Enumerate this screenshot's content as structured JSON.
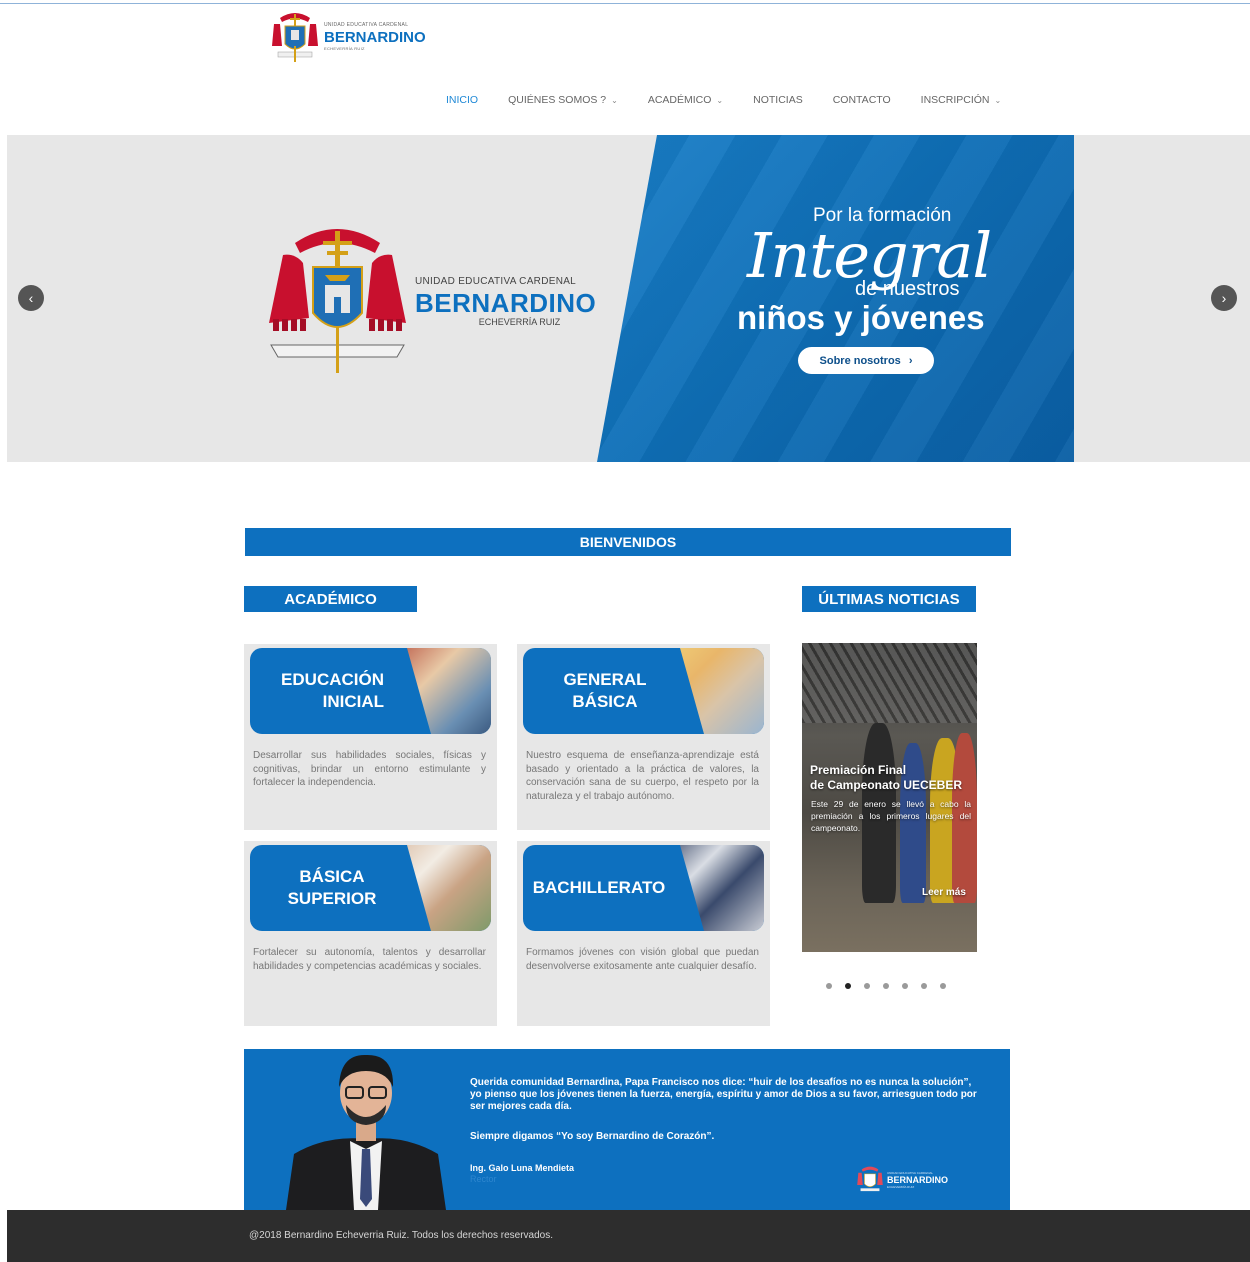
{
  "header": {
    "logo": {
      "small": "UNIDAD EDUCATIVA CARDENAL",
      "big": "BERNARDINO",
      "sub": "ECHEVERRÍA RUIZ"
    },
    "nav": [
      {
        "label": "INICIO",
        "active": true,
        "dropdown": false
      },
      {
        "label": "QUIÉNES SOMOS ?",
        "active": false,
        "dropdown": true
      },
      {
        "label": "ACADÉMICO",
        "active": false,
        "dropdown": true
      },
      {
        "label": "NOTICIAS",
        "active": false,
        "dropdown": false
      },
      {
        "label": "CONTACTO",
        "active": false,
        "dropdown": false
      },
      {
        "label": "INSCRIPCIÓN",
        "active": false,
        "dropdown": true
      }
    ]
  },
  "hero": {
    "logo_small": "UNIDAD EDUCATIVA CARDENAL",
    "logo_big": "BERNARDINO",
    "logo_sub": "ECHEVERRÍA RUIZ",
    "crest_motto": "PAX ET BONUM",
    "line1": "Por la formación",
    "script": "Integral",
    "line3": "de nuestros",
    "line4": "niños y jóvenes",
    "button": "Sobre nosotros",
    "prev_icon": "chevron-left-icon",
    "next_icon": "chevron-right-icon"
  },
  "welcome": "BIENVENIDOS",
  "academic": {
    "heading": "ACADÉMICO",
    "cards": [
      {
        "title_line1": "EDUCACIÓN",
        "title_line2": "INICIAL",
        "desc": "Desarrollar sus habilidades sociales, físicas y cognitivas, brindar un entorno estimulante y fortalecer la independencia."
      },
      {
        "title_line1": "GENERAL",
        "title_line2": "BÁSICA",
        "desc": "Nuestro esquema de enseñanza-aprendizaje está basado y orientado a la práctica de valores, la conservación sana de su cuerpo, el respeto por la naturaleza y el trabajo autónomo."
      },
      {
        "title_line1": "BÁSICA",
        "title_line2": "SUPERIOR",
        "desc": "Fortalecer su autonomía, talentos y desarrollar habilidades y competencias académicas y sociales."
      },
      {
        "title_line1": "BACHILLERATO",
        "title_line2": "",
        "desc": "Formamos jóvenes con visión global que puedan desenvolverse exitosamente ante cualquier desafío."
      }
    ]
  },
  "news": {
    "heading": "ÚLTIMAS NOTICIAS",
    "title_line1": "Premiación Final",
    "title_line2": "de Campeonato UECEBER",
    "text": "Este 29 de enero se llevó a cabo la premiación a los primeros lugares del campeonato.",
    "more": "Leer más",
    "dots_total": 7,
    "dots_active": 2
  },
  "rector": {
    "message": "Querida comunidad Bernardina, Papa Francisco nos dice: “huir  de los desafíos no es nunca la solución”, yo pienso que los jóvenes tienen la fuerza, energía, espíritu y amor de Dios a su favor, arriesguen todo por ser mejores cada día.",
    "motto": "Siempre digamos “Yo soy Bernardino de Corazón”.",
    "name": "Ing. Galo Luna Mendieta",
    "role": "Rector",
    "logo_small": "UNIDAD EDUCATIVA CARDENAL",
    "logo_big": "BERNARDINO",
    "logo_sub": "ECHEVERRÍA RUIZ"
  },
  "footer": "@2018 Bernardino Echeverria Ruiz. Todos los derechos reservados.",
  "colors": {
    "brand_blue": "#0d70bf",
    "nav_active": "#1e88d6",
    "footer_bg": "#2d2d2d",
    "card_bg": "#e7e7e7"
  }
}
